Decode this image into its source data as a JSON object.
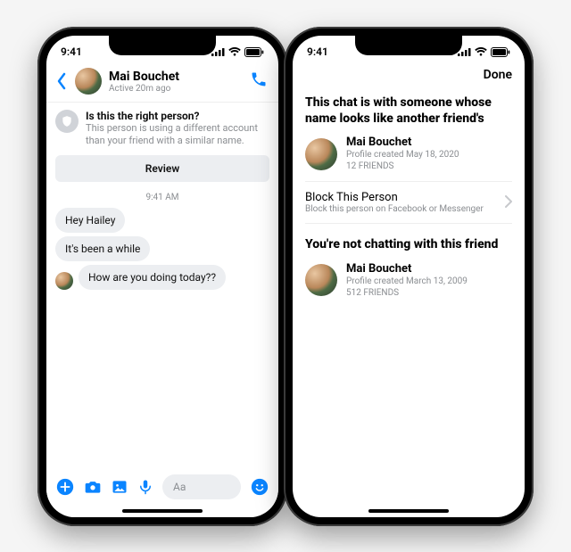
{
  "status": {
    "time": "9:41"
  },
  "chat": {
    "name": "Mai Bouchet",
    "active": "Active 20m ago",
    "banner_title": "Is this the right person?",
    "banner_body": "This person is using a different account than your friend with a similar name.",
    "review": "Review",
    "timestamp": "9:41 AM",
    "messages": [
      "Hey Hailey",
      "It's been a while",
      "How are you doing today??"
    ],
    "composer_placeholder": "Aa"
  },
  "details": {
    "done": "Done",
    "heading1": "This chat is with someone whose name looks like another friend's",
    "person1": {
      "name": "Mai Bouchet",
      "created": "Profile created May 18, 2020",
      "friends": "12 FRIENDS"
    },
    "block": {
      "title": "Block This Person",
      "sub": "Block this person on Facebook or Messenger"
    },
    "heading2": "You're not chatting with this friend",
    "person2": {
      "name": "Mai Bouchet",
      "created": "Profile created March 13, 2009",
      "friends": "512 FRIENDS"
    }
  }
}
